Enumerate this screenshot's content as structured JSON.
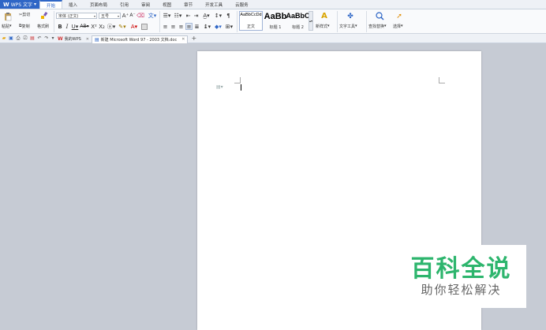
{
  "app": {
    "name": "WPS 文字"
  },
  "menu": {
    "tabs": [
      "开始",
      "插入",
      "页面布局",
      "引用",
      "审阅",
      "视图",
      "章节",
      "开发工具",
      "云服务"
    ]
  },
  "ribbon": {
    "paste": "粘贴",
    "cut": "剪切",
    "copy": "复制",
    "format_painter": "格式刷",
    "font_name": "宋体 (正文)",
    "font_size": "五号",
    "styles": [
      {
        "sample": "AaBbCcDd",
        "label": "正文"
      },
      {
        "sample": "AaBb",
        "label": "标题 1"
      },
      {
        "sample": "AaBbC",
        "label": "标题 2"
      }
    ],
    "new_style": "新样式",
    "text_tools": "文字工具",
    "find_replace": "查找替换",
    "select": "选择"
  },
  "tabs": {
    "items": [
      {
        "label": "我的WPS"
      },
      {
        "label": "新建 Microsoft Word 97 - 2003 文档.doc"
      }
    ],
    "add": "+"
  },
  "watermark": {
    "title": "百科全说",
    "subtitle": "助你轻松解决"
  },
  "colors": {
    "accent": "#2e66c6",
    "watermark_green": "#2db56d",
    "workspace": "#c6cbd4"
  }
}
